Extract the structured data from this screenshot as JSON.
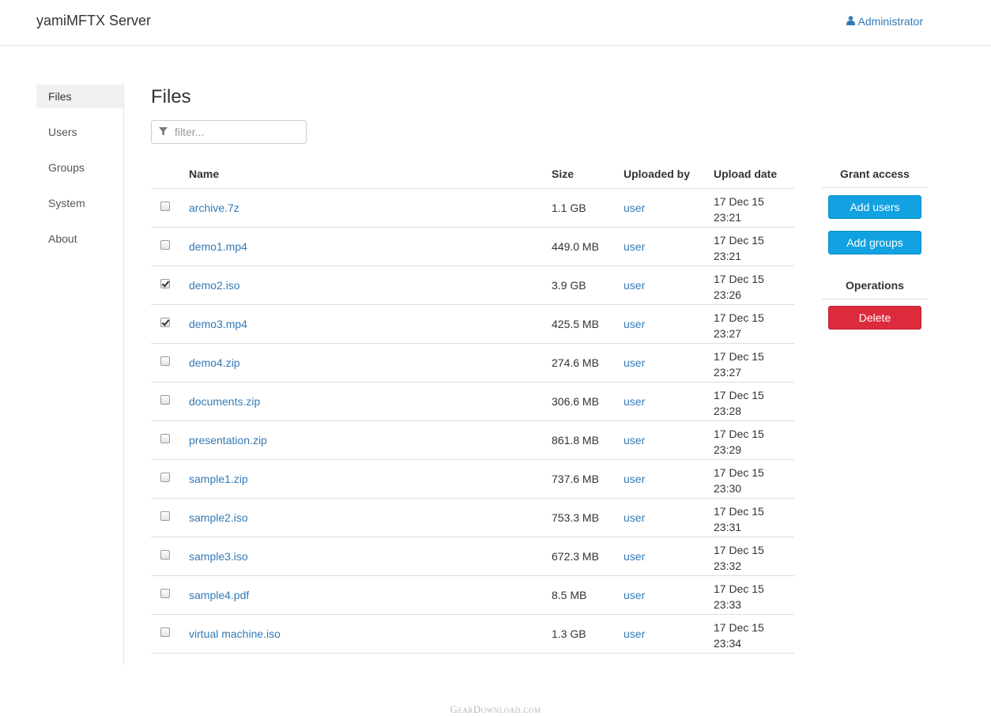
{
  "app": {
    "title": "yamiMFTX Server",
    "user_label": "Administrator",
    "user_icon": "user-icon",
    "accent_color": "#337ab7"
  },
  "sidebar": {
    "items": [
      {
        "label": "Files",
        "active": true
      },
      {
        "label": "Users",
        "active": false
      },
      {
        "label": "Groups",
        "active": false
      },
      {
        "label": "System",
        "active": false
      },
      {
        "label": "About",
        "active": false
      }
    ]
  },
  "main": {
    "title": "Files",
    "filter": {
      "placeholder": "filter...",
      "value": "",
      "icon": "filter-icon"
    },
    "table": {
      "headers": {
        "name": "Name",
        "size": "Size",
        "uploaded_by": "Uploaded by",
        "upload_date": "Upload date"
      },
      "rows": [
        {
          "checked": false,
          "name": "archive.7z",
          "size": "1.1 GB",
          "uploaded_by": "user",
          "date": "17 Dec 15",
          "time": "23:21"
        },
        {
          "checked": false,
          "name": "demo1.mp4",
          "size": "449.0 MB",
          "uploaded_by": "user",
          "date": "17 Dec 15",
          "time": "23:21"
        },
        {
          "checked": true,
          "name": "demo2.iso",
          "size": "3.9 GB",
          "uploaded_by": "user",
          "date": "17 Dec 15",
          "time": "23:26"
        },
        {
          "checked": true,
          "name": "demo3.mp4",
          "size": "425.5 MB",
          "uploaded_by": "user",
          "date": "17 Dec 15",
          "time": "23:27"
        },
        {
          "checked": false,
          "name": "demo4.zip",
          "size": "274.6 MB",
          "uploaded_by": "user",
          "date": "17 Dec 15",
          "time": "23:27"
        },
        {
          "checked": false,
          "name": "documents.zip",
          "size": "306.6 MB",
          "uploaded_by": "user",
          "date": "17 Dec 15",
          "time": "23:28"
        },
        {
          "checked": false,
          "name": "presentation.zip",
          "size": "861.8 MB",
          "uploaded_by": "user",
          "date": "17 Dec 15",
          "time": "23:29"
        },
        {
          "checked": false,
          "name": "sample1.zip",
          "size": "737.6 MB",
          "uploaded_by": "user",
          "date": "17 Dec 15",
          "time": "23:30"
        },
        {
          "checked": false,
          "name": "sample2.iso",
          "size": "753.3 MB",
          "uploaded_by": "user",
          "date": "17 Dec 15",
          "time": "23:31"
        },
        {
          "checked": false,
          "name": "sample3.iso",
          "size": "672.3 MB",
          "uploaded_by": "user",
          "date": "17 Dec 15",
          "time": "23:32"
        },
        {
          "checked": false,
          "name": "sample4.pdf",
          "size": "8.5 MB",
          "uploaded_by": "user",
          "date": "17 Dec 15",
          "time": "23:33"
        },
        {
          "checked": false,
          "name": "virtual machine.iso",
          "size": "1.3 GB",
          "uploaded_by": "user",
          "date": "17 Dec 15",
          "time": "23:34"
        }
      ]
    }
  },
  "actions": {
    "grant_title": "Grant access",
    "add_users": "Add users",
    "add_groups": "Add groups",
    "operations_title": "Operations",
    "delete": "Delete",
    "primary_color": "#12a2e1",
    "danger_color": "#dc2b3d"
  },
  "watermark": "GearDownload.com"
}
